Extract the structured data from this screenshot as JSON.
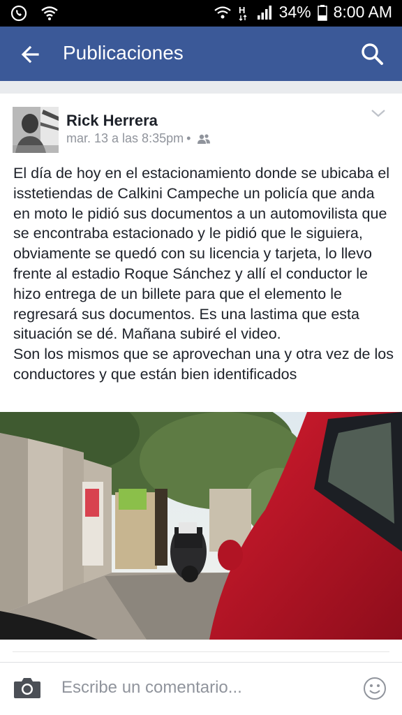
{
  "status_bar": {
    "icons_left": [
      "whatsapp-icon",
      "wifi-icon"
    ],
    "icons_right": [
      "wifi-icon",
      "network-h-icon",
      "signal-icon",
      "battery-icon"
    ],
    "battery": "34%",
    "time": "8:00 AM"
  },
  "app_bar": {
    "title": "Publicaciones",
    "color": "#3b5998",
    "icons": [
      "back-arrow-icon",
      "search-icon"
    ]
  },
  "post": {
    "author": "Rick Herrera",
    "date": "mar. 13 a las 8:35pm",
    "separator": "•",
    "audience_icon": "friends-icon",
    "menu_icon": "chevron-down-icon",
    "paragraph_1": "El día de hoy en el estacionamiento donde se ubicaba el issteti­endas de Calkini Campeche  un policía que anda en moto le pidió sus documentos a un automovilista que se encontraba estacionado y le pidió que le siguiera, obviamente se quedó con su licencia y tarjeta, lo llevo frente al estadio Roque Sánchez y allí el conductor le hizo entrega de un billete para que el elemento le regresará sus documentos. Es una lastima que esta situación se dé. Mañana subiré el video.",
    "paragraph_2": "Son los mismos que se aprovechan una y otra vez de los conductores y que están bien identificados"
  },
  "comment_bar": {
    "placeholder": "Escribe un comentario...",
    "icons": [
      "camera-icon",
      "emoji-icon"
    ]
  }
}
